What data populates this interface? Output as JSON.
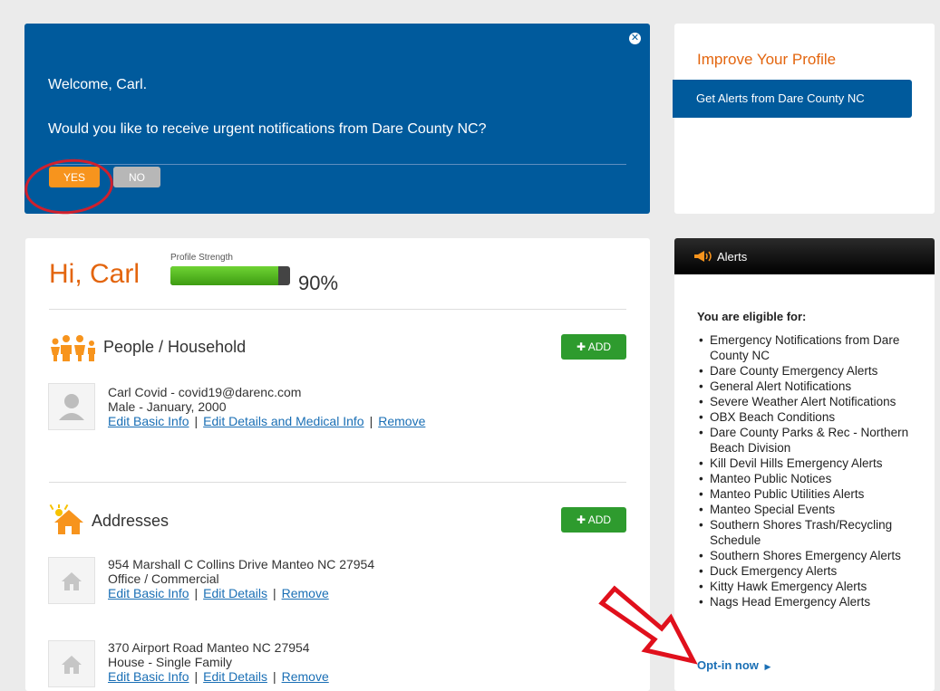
{
  "welcome": {
    "greeting": "Welcome, Carl.",
    "question": "Would you like to receive urgent notifications from Dare County NC?",
    "yes_label": "YES",
    "no_label": "NO"
  },
  "improve": {
    "title": "Improve Your Profile",
    "alerts_button": "Get Alerts from Dare County NC"
  },
  "profile": {
    "greeting": "Hi, Carl",
    "strength_label": "Profile Strength",
    "strength_value": "90%",
    "strength_fraction": 0.9
  },
  "people": {
    "title": "People / Household",
    "add_label": "ADD",
    "person": {
      "line1": "Carl Covid - covid19@darenc.com",
      "line2": "Male - January, 2000",
      "links": [
        "Edit Basic Info",
        "Edit Details and Medical Info",
        "Remove"
      ]
    }
  },
  "addresses": {
    "title": "Addresses",
    "add_label": "ADD",
    "items": [
      {
        "line1": "954 Marshall C Collins Drive Manteo NC 27954",
        "line2": "Office / Commercial",
        "links": [
          "Edit Basic Info",
          "Edit Details",
          "Remove"
        ]
      },
      {
        "line1": "370 Airport Road Manteo NC 27954",
        "line2": "House - Single Family",
        "links": [
          "Edit Basic Info",
          "Edit Details",
          "Remove"
        ]
      }
    ]
  },
  "alerts": {
    "header": "Alerts",
    "eligible_title": "You are eligible for:",
    "items": [
      "Emergency Notifications from Dare County NC",
      "Dare County Emergency Alerts",
      "General Alert Notifications",
      "Severe Weather Alert Notifications",
      "OBX Beach Conditions",
      "Dare County Parks & Rec - Northern Beach Division",
      "Kill Devil Hills Emergency Alerts",
      "Manteo Public Notices",
      "Manteo Public Utilities Alerts",
      "Manteo Special Events",
      "Southern Shores Trash/Recycling Schedule",
      "Southern Shores Emergency Alerts",
      "Duck Emergency Alerts",
      "Kitty Hawk Emergency Alerts",
      "Nags Head Emergency Alerts"
    ],
    "optin_label": "Opt-in now"
  },
  "colors": {
    "brand_blue": "#005a9c",
    "accent_orange": "#f7941d",
    "add_green": "#2e9b2e",
    "annotation_red": "#d0202d"
  }
}
